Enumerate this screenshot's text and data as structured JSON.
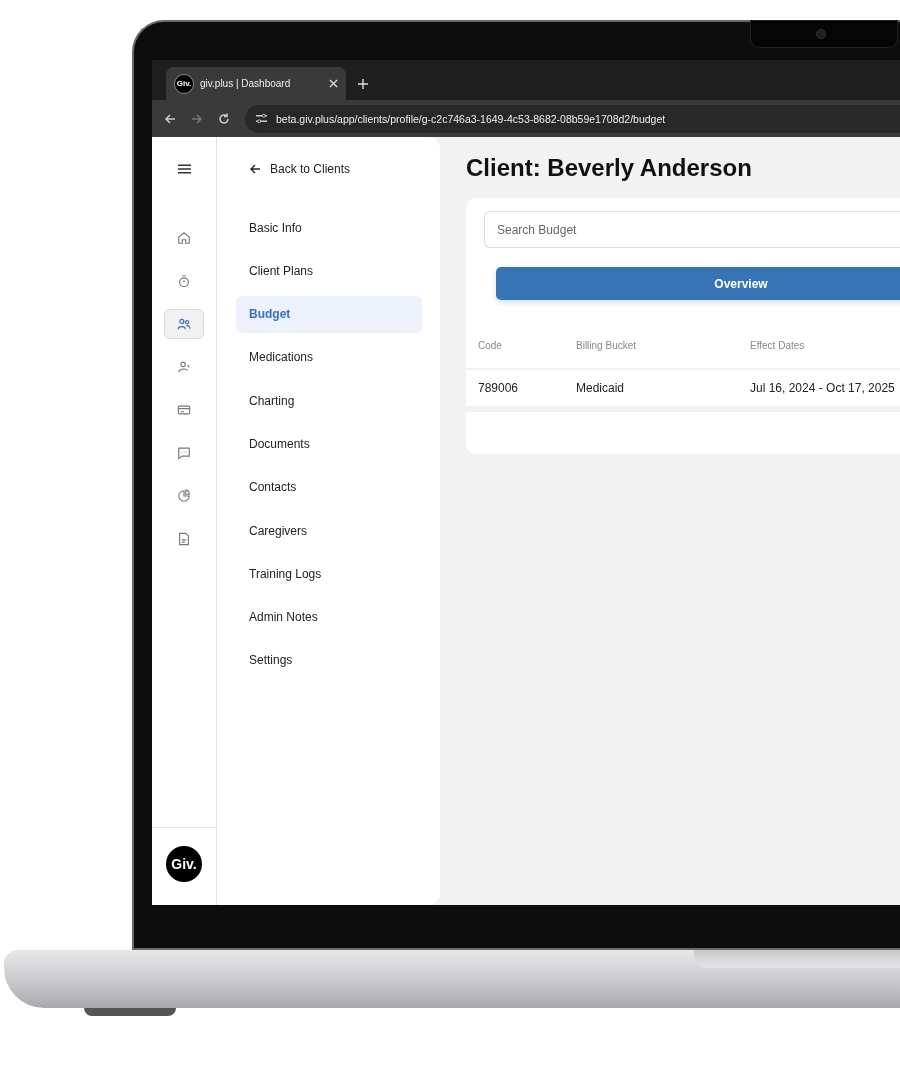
{
  "browser": {
    "tab": {
      "favicon_text": "Giv.",
      "title": "giv.plus | Dashboard"
    },
    "url": "beta.giv.plus/app/clients/profile/g-c2c746a3-1649-4c53-8682-08b59e1708d2/budget"
  },
  "rail": {
    "items": [
      {
        "kind": "home",
        "selected": false
      },
      {
        "kind": "timer",
        "selected": false
      },
      {
        "kind": "people",
        "selected": true
      },
      {
        "kind": "person",
        "selected": false
      },
      {
        "kind": "card",
        "selected": false
      },
      {
        "kind": "chat",
        "selected": false
      },
      {
        "kind": "pie",
        "selected": false
      },
      {
        "kind": "document",
        "selected": false
      }
    ],
    "logo": "Giv."
  },
  "sidebar": {
    "back": "Back to Clients",
    "items": [
      {
        "label": "Basic Info",
        "selected": false
      },
      {
        "label": "Client Plans",
        "selected": false
      },
      {
        "label": "Budget",
        "selected": true
      },
      {
        "label": "Medications",
        "selected": false
      },
      {
        "label": "Charting",
        "selected": false
      },
      {
        "label": "Documents",
        "selected": false
      },
      {
        "label": "Contacts",
        "selected": false
      },
      {
        "label": "Caregivers",
        "selected": false
      },
      {
        "label": "Training Logs",
        "selected": false
      },
      {
        "label": "Admin Notes",
        "selected": false
      },
      {
        "label": "Settings",
        "selected": false
      }
    ]
  },
  "title": "Client: Beverly Anderson",
  "search": {
    "placeholder": "Search Budget"
  },
  "overview_button": "Overview",
  "table": {
    "columns": [
      "Code",
      "Billing Bucket",
      "Effect Dates"
    ],
    "rows": [
      [
        "789006",
        "Medicaid",
        "Jul 16, 2024 - Oct 17, 2025"
      ]
    ]
  }
}
